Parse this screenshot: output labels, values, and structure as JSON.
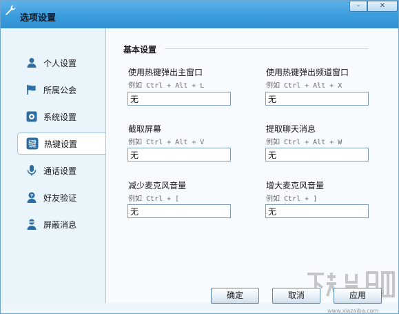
{
  "window": {
    "title": "选项设置",
    "title_icon": "wrench-icon",
    "minimize_glyph": "–",
    "close_glyph": "✕"
  },
  "sidebar": {
    "active_index": 3,
    "items": [
      {
        "label": "个人设置",
        "icon": "person-icon"
      },
      {
        "label": "所属公会",
        "icon": "flag-icon"
      },
      {
        "label": "系统设置",
        "icon": "system-icon"
      },
      {
        "label": "热键设置",
        "icon": "key-icon",
        "icon_text": "键"
      },
      {
        "label": "通话设置",
        "icon": "microphone-icon"
      },
      {
        "label": "好友验证",
        "icon": "friend-verify-icon"
      },
      {
        "label": "屏蔽消息",
        "icon": "block-user-icon"
      }
    ]
  },
  "main": {
    "section_title": "基本设置",
    "hotkeys": [
      {
        "label": "使用热键弹出主窗口",
        "hint": "例如 Ctrl + Alt + L",
        "value": "无"
      },
      {
        "label": "使用热键弹出频道窗口",
        "hint": "例如 Ctrl + Alt + X",
        "value": "无"
      },
      {
        "label": "截取屏幕",
        "hint": "例如 Ctrl + Alt + V",
        "value": "无"
      },
      {
        "label": "提取聊天消息",
        "hint": "例如 Ctrl + Alt + W",
        "value": "无"
      },
      {
        "label": "减少麦克风音量",
        "hint": "例如 Ctrl + [",
        "value": "无"
      },
      {
        "label": "增大麦克风音量",
        "hint": "例如 Ctrl + ]",
        "value": "无"
      }
    ]
  },
  "footer": {
    "ok_label": "确定",
    "cancel_label": "取消",
    "apply_label": "应用"
  },
  "colors": {
    "titlebar": "#3b9ddd",
    "accent_icon": "#2f6ea3",
    "sidebar_bg": "#eaf4fb",
    "content_bg": "#f7fbfe"
  },
  "watermark": {
    "text": "www.xiazaiba.com"
  }
}
